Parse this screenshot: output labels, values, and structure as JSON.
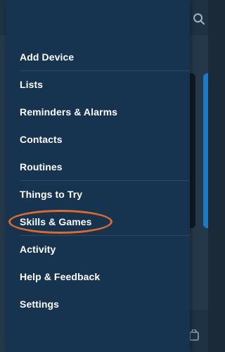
{
  "menu": {
    "items": [
      {
        "label": "Add Device"
      },
      {
        "label": "Lists"
      },
      {
        "label": "Reminders & Alarms"
      },
      {
        "label": "Contacts"
      },
      {
        "label": "Routines"
      },
      {
        "label": "Things to Try"
      },
      {
        "label": "Skills & Games"
      },
      {
        "label": "Activity"
      },
      {
        "label": "Help & Feedback"
      },
      {
        "label": "Settings"
      }
    ]
  },
  "icons": {
    "search": "search-icon",
    "bottom": "bag-icon"
  },
  "colors": {
    "drawer_bg": "#163350",
    "highlight": "#e06a2a",
    "accent_blue": "#1e79c3"
  }
}
